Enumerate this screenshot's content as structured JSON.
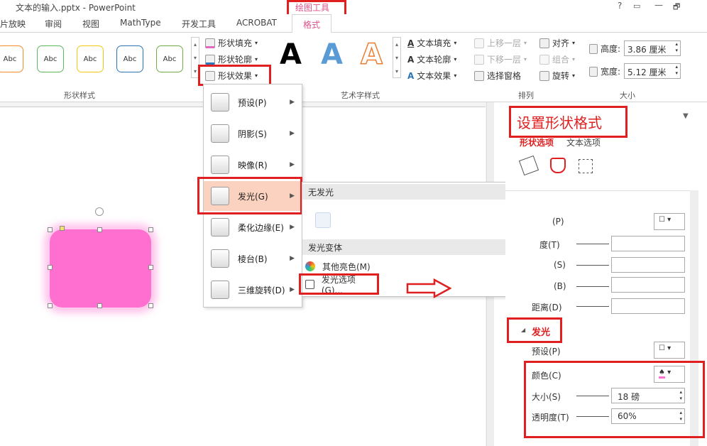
{
  "window": {
    "title": "文本的输入.pptx - PowerPoint",
    "help": "?",
    "restore": "▭",
    "minimize": "—",
    "maximize": "🗗"
  },
  "context_tab_group": {
    "label": "绘图工具"
  },
  "tabs": [
    {
      "label": "片放映"
    },
    {
      "label": "审阅"
    },
    {
      "label": "视图"
    },
    {
      "label": "MathType"
    },
    {
      "label": "开发工具"
    },
    {
      "label": "ACROBAT"
    },
    {
      "label": "格式"
    }
  ],
  "ribbon": {
    "shape_styles": {
      "group_label": "形状样式",
      "samples": [
        "Abc",
        "Abc",
        "Abc",
        "Abc",
        "Abc"
      ],
      "sample_colors": [
        "#f28c28",
        "#5cb85c",
        "#f2c811",
        "#2e75b6",
        "#70ad47"
      ]
    },
    "shape_fill": "形状填充",
    "shape_outline": "形状轮廓",
    "shape_effects": "形状效果",
    "wordart": {
      "group_label": "艺术字样式",
      "letters": [
        "A",
        "A",
        "A"
      ],
      "colors": [
        "#000000",
        "#5b9bd5",
        "#ed7d31"
      ]
    },
    "text_fill": "文本填充",
    "text_outline": "文本轮廓",
    "text_effects": "文本效果",
    "arrange": {
      "group_label": "排列",
      "bring_forward": "上移一层",
      "send_backward": "下移一层",
      "selection_pane": "选择窗格",
      "align": "对齐",
      "group": "组合",
      "rotate": "旋转"
    },
    "size": {
      "group_label": "大小",
      "height_label": "高度:",
      "height_value": "3.86 厘米",
      "width_label": "宽度:",
      "width_value": "5.12 厘米"
    }
  },
  "effects_menu": {
    "items": [
      {
        "label": "预设(P)"
      },
      {
        "label": "阴影(S)"
      },
      {
        "label": "映像(R)"
      },
      {
        "label": "发光(G)"
      },
      {
        "label": "柔化边缘(E)"
      },
      {
        "label": "棱台(B)"
      },
      {
        "label": "三维旋转(D)"
      }
    ]
  },
  "glow_submenu": {
    "no_glow": "无发光",
    "variants": "发光变体",
    "more_colors": "其他亮色(M)",
    "glow_options": "发光选项(G)..."
  },
  "format_pane": {
    "title": "设置形状格式",
    "tab_shape": "形状选项",
    "tab_text": "文本选项",
    "shadow_rows": [
      {
        "label": "(P)"
      },
      {
        "label": "度(T)"
      },
      {
        "label": "(S)"
      },
      {
        "label": "(B)"
      },
      {
        "label": "距离(D)"
      }
    ],
    "glow_section": "发光",
    "glow_preset": "预设(P)",
    "glow_color": "颜色(C)",
    "glow_size_label": "大小(S)",
    "glow_size_value": "18 磅",
    "glow_transparency_label": "透明度(T)",
    "glow_transparency_value": "60%"
  }
}
